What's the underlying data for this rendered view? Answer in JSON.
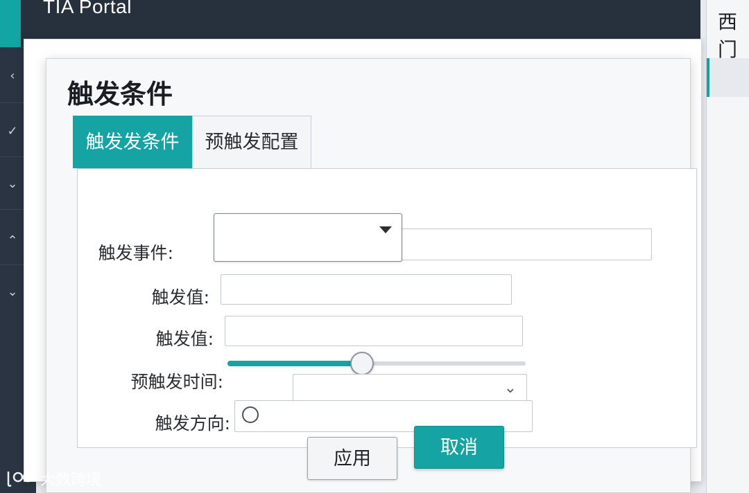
{
  "app": {
    "title": "TIA Portal"
  },
  "right_panel": {
    "title": "西门"
  },
  "sidebar": {
    "chevrons": [
      "‹",
      "✓",
      "⌄",
      "⌃",
      "⌄"
    ]
  },
  "dialog": {
    "title": "触发条件",
    "tabs": [
      {
        "label": "触发发条件",
        "active": true
      },
      {
        "label": "预触发配置",
        "active": false
      }
    ],
    "fields": {
      "trigger_event": {
        "label": "触发事件:",
        "value": ""
      },
      "trigger_value_1": {
        "label": "触发值:",
        "value": ""
      },
      "trigger_value_2": {
        "label": "触发值:",
        "value": ""
      },
      "pretrigger_time": {
        "label": "预触发时间:",
        "slider_fraction": 0.45
      },
      "trigger_direction": {
        "label": "触发方向:",
        "value": ""
      }
    },
    "buttons": {
      "apply": "应用",
      "cancel": "取消"
    }
  },
  "watermark": {
    "text": "大数跨境"
  },
  "colors": {
    "accent": "#15a3a3",
    "sidebar": "#2b3442",
    "titlebar": "#27303d"
  }
}
